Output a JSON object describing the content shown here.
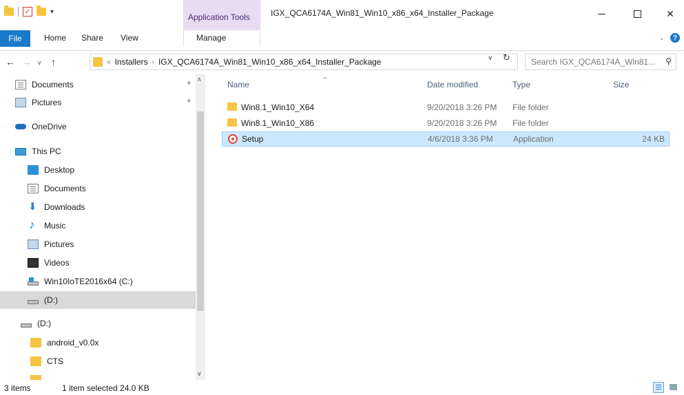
{
  "window": {
    "title": "IGX_QCA6174A_Win81_Win10_x86_x64_Installer_Package",
    "contextual_tab_group": "Application Tools",
    "controls": {
      "minimize": "—",
      "maximize": "☐",
      "close": "✕"
    }
  },
  "ribbon": {
    "tabs": [
      "File",
      "Home",
      "Share",
      "View"
    ],
    "contextual_tab": "Manage",
    "help": "?"
  },
  "address": {
    "overflow": "«",
    "breadcrumb": [
      "Installers",
      "IGX_QCA6174A_Win81_Win10_x86_x64_Installer_Package"
    ],
    "separator": "›",
    "search_placeholder": "Search IGX_QCA6174A_Win81..."
  },
  "sidebar": {
    "items": [
      {
        "label": "Documents",
        "icon": "documents-icon",
        "pinned": true
      },
      {
        "label": "Pictures",
        "icon": "pictures-icon",
        "pinned": true
      },
      {
        "label": "OneDrive",
        "icon": "onedrive-icon"
      },
      {
        "label": "This PC",
        "icon": "this-pc-icon"
      },
      {
        "label": "Desktop",
        "icon": "desktop-icon"
      },
      {
        "label": "Documents",
        "icon": "documents-icon"
      },
      {
        "label": "Downloads",
        "icon": "downloads-icon"
      },
      {
        "label": "Music",
        "icon": "music-icon"
      },
      {
        "label": "Pictures",
        "icon": "pictures-icon"
      },
      {
        "label": "Videos",
        "icon": "videos-icon"
      },
      {
        "label": "Win10IoTE2016x64 (C:)",
        "icon": "os-drive-icon"
      },
      {
        "label": "(D:)",
        "icon": "drive-icon",
        "selected": true
      },
      {
        "label": "(D:)",
        "icon": "drive-icon"
      },
      {
        "label": "android_v0.0x",
        "icon": "folder-icon"
      },
      {
        "label": "CTS",
        "icon": "folder-icon"
      }
    ]
  },
  "columns": {
    "name": "Name",
    "date": "Date modified",
    "type": "Type",
    "size": "Size"
  },
  "files": [
    {
      "name": "Win8.1_Win10_X64",
      "date": "9/20/2018 3:26 PM",
      "type": "File folder",
      "size": "",
      "kind": "folder"
    },
    {
      "name": "Win8.1_Win10_X86",
      "date": "9/20/2018 3:26 PM",
      "type": "File folder",
      "size": "",
      "kind": "folder"
    },
    {
      "name": "Setup",
      "date": "4/6/2018 3:36 PM",
      "type": "Application",
      "size": "24 KB",
      "kind": "app",
      "selected": true
    }
  ],
  "status": {
    "items": "3 items",
    "selection": "1 item selected  24.0 KB"
  }
}
